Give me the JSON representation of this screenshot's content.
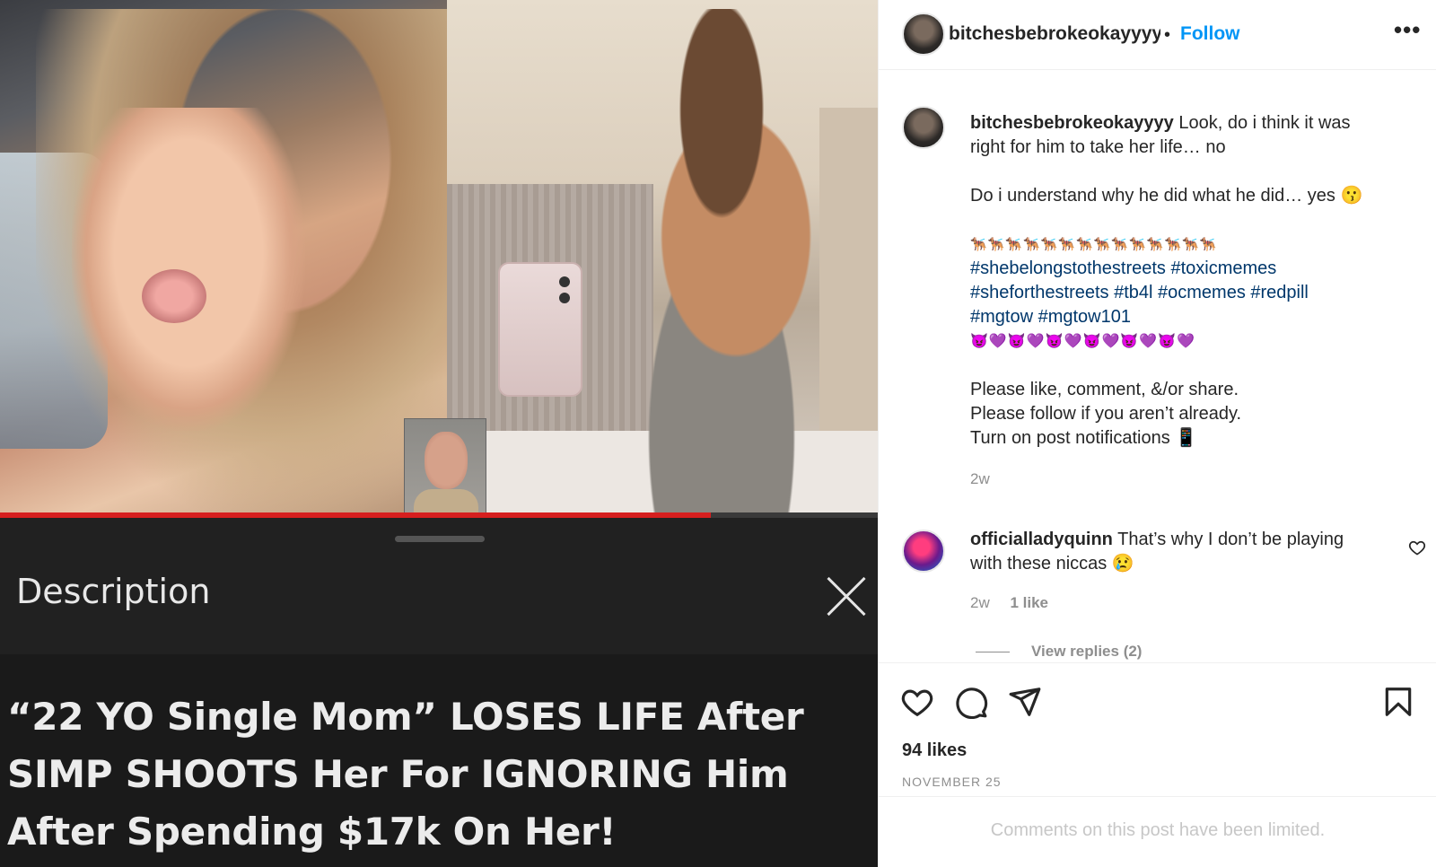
{
  "media": {
    "video_progress": 0.81,
    "sheet_title": "Description",
    "headline": "“22 YO Single Mom” LOSES LIFE After SIMP SHOOTS Her For IGNORING Him After Spending $17k On Her!"
  },
  "post": {
    "username": "bitchesbebrokeokayyyy",
    "header_username_truncated": "bitchesbebrokeokayyyy",
    "dot": "•",
    "follow_label": "Follow",
    "more_label": "•••",
    "caption": {
      "author": "bitchesbebrokeokayyyy",
      "line1": "Look, do i think it was",
      "line2": "right for him to take her life… no",
      "line3": "Do i understand why he did what he did… yes 😗",
      "line4": "🐕‍🦺🐕‍🦺🐕‍🦺🐕‍🦺🐕‍🦺🐕‍🦺🐕‍🦺🐕‍🦺🐕‍🦺🐕‍🦺🐕‍🦺🐕‍🦺🐕‍🦺🐕‍🦺",
      "tags1": "#shebelongstothestreets #toxicmemes",
      "tags2": "#sheforthestreets #tb4l #ocmemes #redpill",
      "tags3": "#mgtow #mgtow101",
      "line5": "😈💜😈💜😈💜😈💜😈💜😈💜",
      "line6": "Please like, comment, &/or share.",
      "line7": "Please follow if you aren’t already.",
      "line8": "Turn on post notifications 📱",
      "time": "2w"
    },
    "comment": {
      "author": "officialladyquinn",
      "text_line1": "That’s why I don’t be playing",
      "text_line2": "with these niccas 😢",
      "time": "2w",
      "likes": "1 like",
      "view_replies": "View replies (2)"
    },
    "likes": "94 likes",
    "date": "NOVEMBER 25",
    "limited_text": "Comments on this post have been limited."
  },
  "colors": {
    "accent": "#0095f6",
    "hashtag": "#00376b",
    "progress": "#d61f1f"
  }
}
